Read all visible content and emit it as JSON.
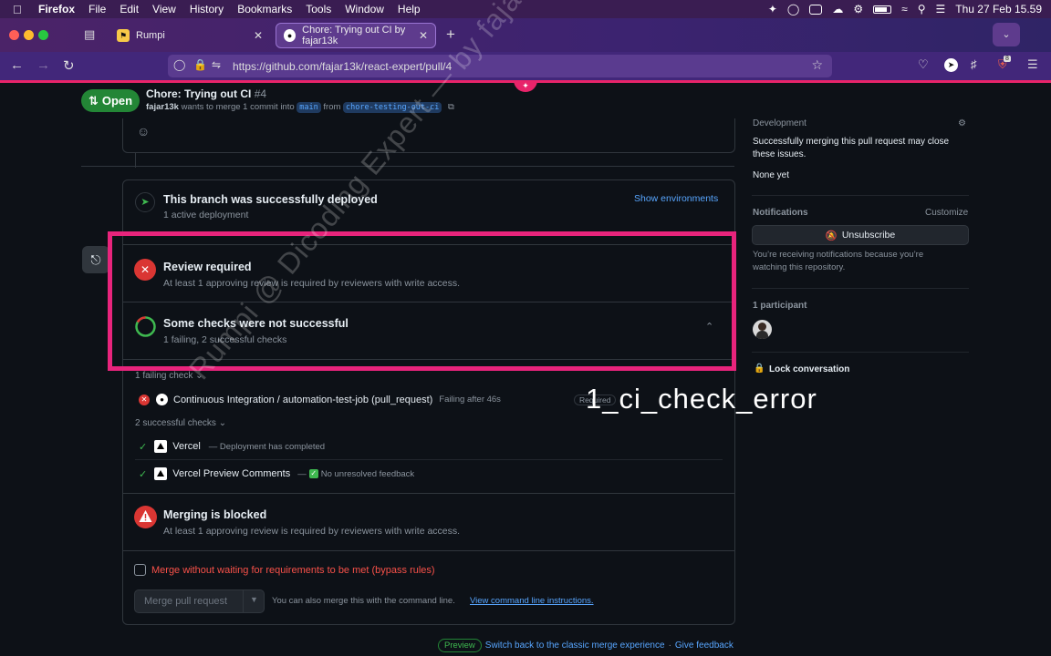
{
  "menubar": {
    "app": "Firefox",
    "items": [
      "File",
      "Edit",
      "View",
      "History",
      "Bookmarks",
      "Tools",
      "Window",
      "Help"
    ],
    "clock": "Thu 27 Feb  15.59"
  },
  "tabs": [
    {
      "label": "Rumpi",
      "favicon_color": "#f7c948"
    },
    {
      "label": "Chore: Trying out CI by fajar13k",
      "favicon_color": "#ffffff"
    }
  ],
  "navbar": {
    "url": "https://github.com/fajar13k/react-expert/pull/4",
    "extension_badge": "8"
  },
  "pr": {
    "status": "Open",
    "title": "Chore: Trying out CI",
    "number": "#4",
    "author": "fajar13k",
    "merge_text": "wants to merge 1 commit into",
    "base_branch": "main",
    "from_text": "from",
    "head_branch": "chore-testing-out-ci"
  },
  "deployment": {
    "title": "This branch was successfully deployed",
    "subtitle": "1 active deployment",
    "action": "Show environments"
  },
  "review": {
    "title": "Review required",
    "subtitle": "At least 1 approving review is required by reviewers with write access."
  },
  "checks": {
    "title": "Some checks were not successful",
    "subtitle": "1 failing, 2 successful checks",
    "failing_header": "1 failing check",
    "failing": [
      {
        "name": "Continuous Integration / automation-test-job (pull_request)",
        "status": "Failing after 46s",
        "tag": "Required"
      }
    ],
    "successful_header": "2 successful checks",
    "successful": [
      {
        "name": "Vercel",
        "status": "— Deployment has completed"
      },
      {
        "name": "Vercel Preview Comments",
        "status": "No unresolved feedback"
      }
    ]
  },
  "merge": {
    "blocked_title": "Merging is blocked",
    "blocked_subtitle": "At least 1 approving review is required by reviewers with write access.",
    "bypass_label": "Merge without waiting for requirements to be met (bypass rules)",
    "button_label": "Merge pull request",
    "cli_text": "You can also merge this with the command line.",
    "cli_link": "View command line instructions."
  },
  "footer": {
    "pill": "Preview",
    "switch_link": "Switch back to the classic merge experience",
    "dot": "·",
    "feedback_link": "Give feedback"
  },
  "sidebar": {
    "development_label": "Development",
    "development_text": "Successfully merging this pull request may close these issues.",
    "development_none": "None yet",
    "notifications_label": "Notifications",
    "customize": "Customize",
    "unsubscribe": "Unsubscribe",
    "notifications_text": "You’re receiving notifications because you’re watching this repository.",
    "participants_label": "1 participant",
    "lock": "Lock conversation"
  },
  "overlay": {
    "watermark": "Rumpi @ Dicoding Expert — by fajar13k",
    "label": "1_ci_check_error",
    "highlight_color": "#e8247c"
  }
}
